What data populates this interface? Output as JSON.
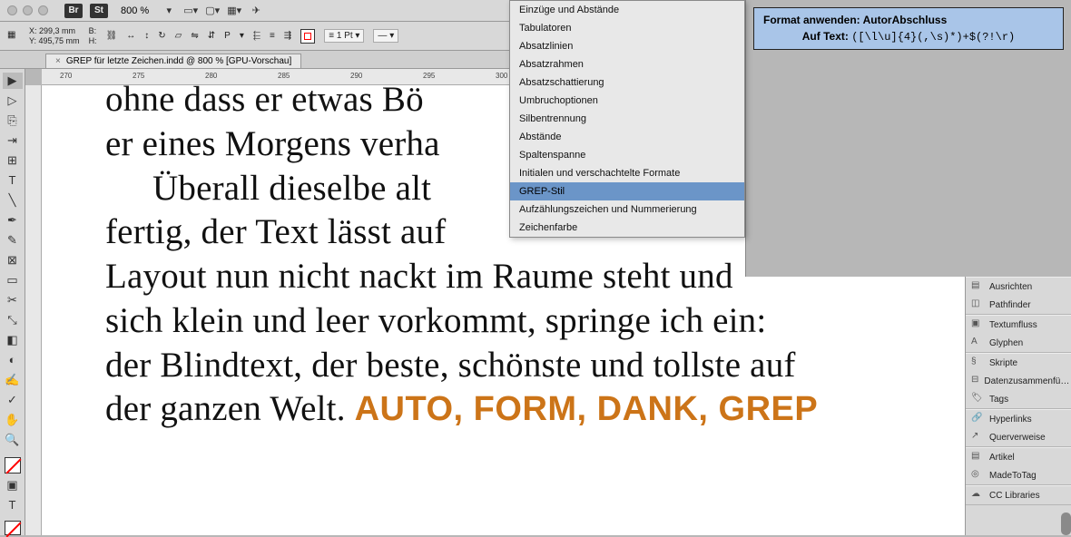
{
  "toolbar": {
    "br_label": "Br",
    "st_label": "St",
    "zoom": "800 %"
  },
  "control": {
    "x_label": "X:",
    "y_label": "Y:",
    "x_value": "299,3 mm",
    "y_value": "495,75 mm",
    "w_label": "B:",
    "h_label": "H:",
    "stroke_value": "1 Pt",
    "p_label": "P"
  },
  "tab": {
    "title": "GREP für letzte Zeichen.indd @ 800 % [GPU-Vorschau]"
  },
  "ruler_ticks": [
    "270",
    "275",
    "280",
    "285",
    "290",
    "295",
    "300"
  ],
  "document": {
    "line1": "ohne  dass  er  etwas  Bö",
    "line2": "er eines Morgens verha",
    "line3": "Überall dieselbe alt",
    "line4": "fertig, der Text lässt auf",
    "line5": "Layout nun nicht nackt im Raume steht und",
    "line6": "sich klein und leer vorkommt, springe ich ein:",
    "line7": "der Blindtext, der beste, schönste und tollste auf",
    "line8a": "der ganzen Welt. ",
    "line8b": "AUTO, FORM, DANK, GREP"
  },
  "menu": {
    "items": [
      "Einzüge und Abstände",
      "Tabulatoren",
      "Absatzlinien",
      "Absatzrahmen",
      "Absatzschattierung",
      "Umbruchoptionen",
      "Silbentrennung",
      "Abstände",
      "Spaltenspanne",
      "Initialen und verschachtelte Formate",
      "GREP-Stil",
      "Aufzählungszeichen und Nummerierung",
      "Zeichenfarbe"
    ],
    "selected_index": 10
  },
  "info_panel": {
    "line1_label": "Format anwenden: ",
    "line1_value": "AutorAbschluss",
    "line2_label": "Auf Text: ",
    "line2_value": "([\\l\\u]{4}(,\\s)*)+$(?!\\r)"
  },
  "dock": {
    "groups": [
      [
        "Ausrichten",
        "Pathfinder"
      ],
      [
        "Textumfluss",
        "Glyphen"
      ],
      [
        "Skripte",
        "Datenzusammenfü…",
        "Tags"
      ],
      [
        "Hyperlinks",
        "Querverweise"
      ],
      [
        "Artikel",
        "MadeToTag"
      ],
      [
        "CC Libraries"
      ]
    ]
  }
}
